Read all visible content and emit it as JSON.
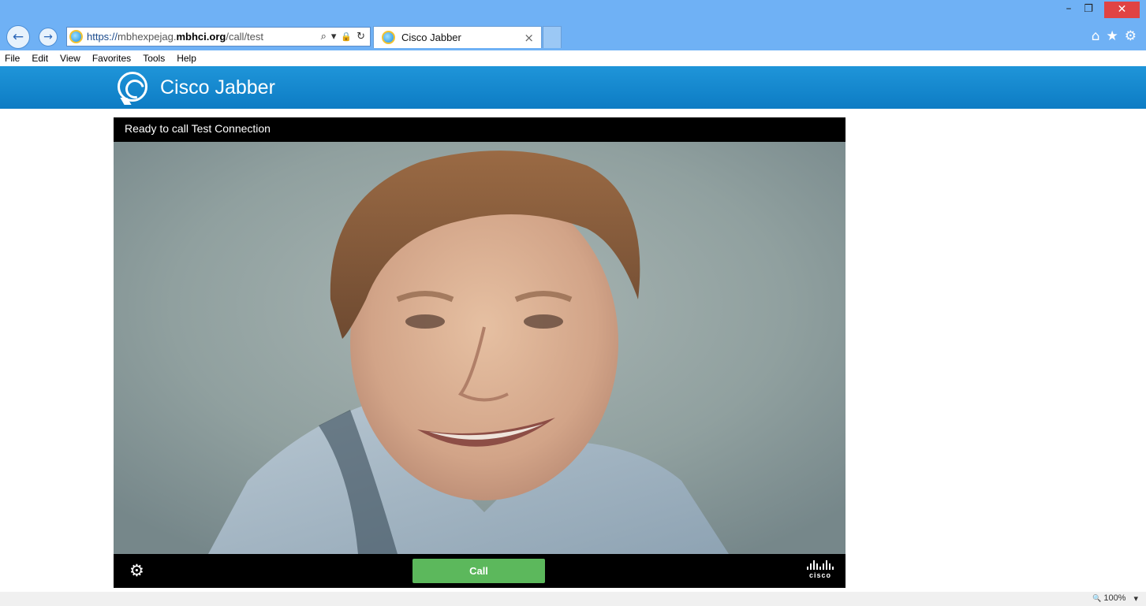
{
  "browser": {
    "url_scheme": "https://",
    "url_domain_prefix": "mbhexpejag.",
    "url_domain_main": "mbhci.org",
    "url_path": "/call/test",
    "tab_title": "Cisco Jabber",
    "tab_close": "×",
    "back_icon": "←",
    "forward_icon": "→",
    "search_icon": "⌕",
    "dropdown_icon": "▾",
    "lock_icon": "🔒",
    "refresh_icon": "↻",
    "minimize": "–",
    "restore": "❐",
    "close": "✕",
    "home_icon": "⌂",
    "star_icon": "★",
    "gear_icon": "⚙"
  },
  "menubar": {
    "items": [
      "File",
      "Edit",
      "View",
      "Favorites",
      "Tools",
      "Help"
    ]
  },
  "app": {
    "title": "Cisco Jabber"
  },
  "call": {
    "status": "Ready to call Test Connection",
    "settings_icon": "⚙",
    "call_label": "Call",
    "brand_word": "cisco"
  },
  "statusbar": {
    "zoom_icon": "🔍",
    "zoom_level": "100%",
    "zoom_dropdown": "▾"
  },
  "colors": {
    "titlebar": "#6fb1f5",
    "jabber_header": "#1a8fd4",
    "call_button": "#5cb85c",
    "close_button": "#e04343"
  }
}
